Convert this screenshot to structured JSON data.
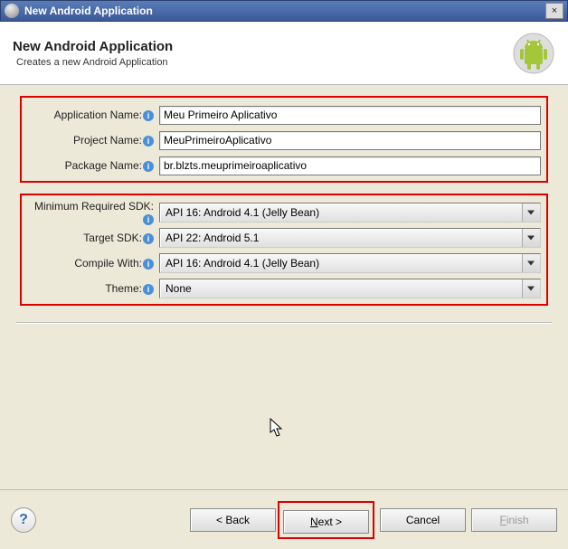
{
  "titlebar": {
    "title": "New Android Application",
    "close": "×"
  },
  "header": {
    "title": "New Android Application",
    "subtitle": "Creates a new Android Application"
  },
  "group1": {
    "appName": {
      "label": "Application Name:",
      "value": "Meu Primeiro Aplicativo"
    },
    "projName": {
      "label": "Project Name:",
      "value": "MeuPrimeiroAplicativo"
    },
    "pkgName": {
      "label": "Package Name:",
      "value": "br.blzts.meuprimeiroaplicativo"
    }
  },
  "group2": {
    "minSdk": {
      "label": "Minimum Required SDK:",
      "value": "API 16: Android 4.1 (Jelly Bean)"
    },
    "targetSdk": {
      "label": "Target SDK:",
      "value": "API 22: Android 5.1"
    },
    "compile": {
      "label": "Compile With:",
      "value": "API 16: Android 4.1 (Jelly Bean)"
    },
    "theme": {
      "label": "Theme:",
      "value": "None"
    }
  },
  "footer": {
    "back": "< Back",
    "next": "Next >",
    "cancel": "Cancel",
    "finish": "Finish"
  }
}
